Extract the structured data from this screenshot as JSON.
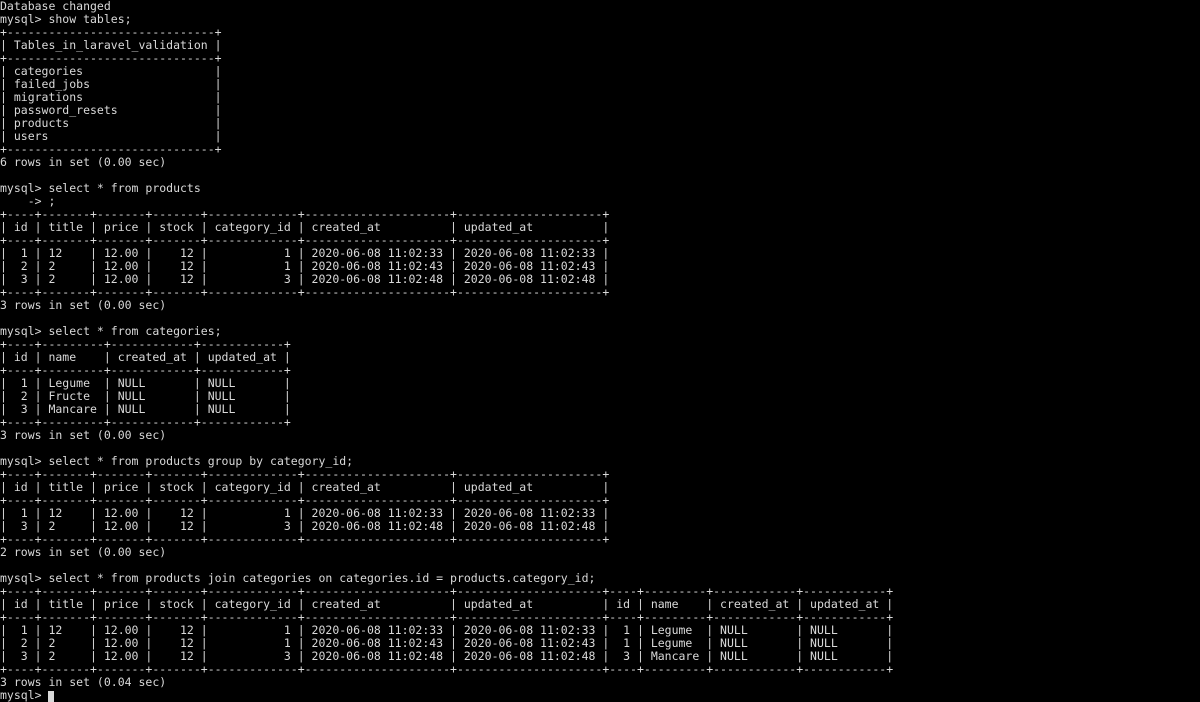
{
  "intro": [
    "Database changed"
  ],
  "prompt": "mysql>",
  "cont": "    ->",
  "cmd_show_tables": "show tables;",
  "tables_header": "Tables_in_laravel_validation",
  "tables": [
    "categories",
    "failed_jobs",
    "migrations",
    "password_resets",
    "products",
    "users"
  ],
  "tables_footer": "6 rows in set (0.00 sec)",
  "cmd_products": "select * from products",
  "cmd_products_cont": ";",
  "products_cols": [
    "id",
    "title",
    "price",
    "stock",
    "category_id",
    "created_at",
    "updated_at"
  ],
  "products_rows": [
    {
      "id": "1",
      "title": "12",
      "price": "12.00",
      "stock": "12",
      "category_id": "1",
      "created_at": "2020-06-08 11:02:33",
      "updated_at": "2020-06-08 11:02:33"
    },
    {
      "id": "2",
      "title": "2",
      "price": "12.00",
      "stock": "12",
      "category_id": "1",
      "created_at": "2020-06-08 11:02:43",
      "updated_at": "2020-06-08 11:02:43"
    },
    {
      "id": "3",
      "title": "2",
      "price": "12.00",
      "stock": "12",
      "category_id": "3",
      "created_at": "2020-06-08 11:02:48",
      "updated_at": "2020-06-08 11:02:48"
    }
  ],
  "products_footer": "3 rows in set (0.00 sec)",
  "cmd_categories": "select * from categories;",
  "categories_cols": [
    "id",
    "name",
    "created_at",
    "updated_at"
  ],
  "categories_rows": [
    {
      "id": "1",
      "name": "Legume",
      "created_at": "NULL",
      "updated_at": "NULL"
    },
    {
      "id": "2",
      "name": "Fructe",
      "created_at": "NULL",
      "updated_at": "NULL"
    },
    {
      "id": "3",
      "name": "Mancare",
      "created_at": "NULL",
      "updated_at": "NULL"
    }
  ],
  "categories_footer": "3 rows in set (0.00 sec)",
  "cmd_group": "select * from products group by category_id;",
  "group_rows": [
    {
      "id": "1",
      "title": "12",
      "price": "12.00",
      "stock": "12",
      "category_id": "1",
      "created_at": "2020-06-08 11:02:33",
      "updated_at": "2020-06-08 11:02:33"
    },
    {
      "id": "3",
      "title": "2",
      "price": "12.00",
      "stock": "12",
      "category_id": "3",
      "created_at": "2020-06-08 11:02:48",
      "updated_at": "2020-06-08 11:02:48"
    }
  ],
  "group_footer": "2 rows in set (0.00 sec)",
  "cmd_join": "select * from products join categories on categories.id = products.category_id;",
  "join_cols": [
    "id",
    "title",
    "price",
    "stock",
    "category_id",
    "created_at",
    "updated_at",
    "id",
    "name",
    "created_at",
    "updated_at"
  ],
  "join_rows": [
    {
      "id": "1",
      "title": "12",
      "price": "12.00",
      "stock": "12",
      "category_id": "1",
      "created_at": "2020-06-08 11:02:33",
      "updated_at": "2020-06-08 11:02:33",
      "cid": "1",
      "name": "Legume",
      "c_created": "NULL",
      "c_updated": "NULL"
    },
    {
      "id": "2",
      "title": "2",
      "price": "12.00",
      "stock": "12",
      "category_id": "1",
      "created_at": "2020-06-08 11:02:43",
      "updated_at": "2020-06-08 11:02:43",
      "cid": "1",
      "name": "Legume",
      "c_created": "NULL",
      "c_updated": "NULL"
    },
    {
      "id": "3",
      "title": "2",
      "price": "12.00",
      "stock": "12",
      "category_id": "3",
      "created_at": "2020-06-08 11:02:48",
      "updated_at": "2020-06-08 11:02:48",
      "cid": "3",
      "name": "Mancare",
      "c_created": "NULL",
      "c_updated": "NULL"
    }
  ],
  "join_footer": "3 rows in set (0.04 sec)"
}
